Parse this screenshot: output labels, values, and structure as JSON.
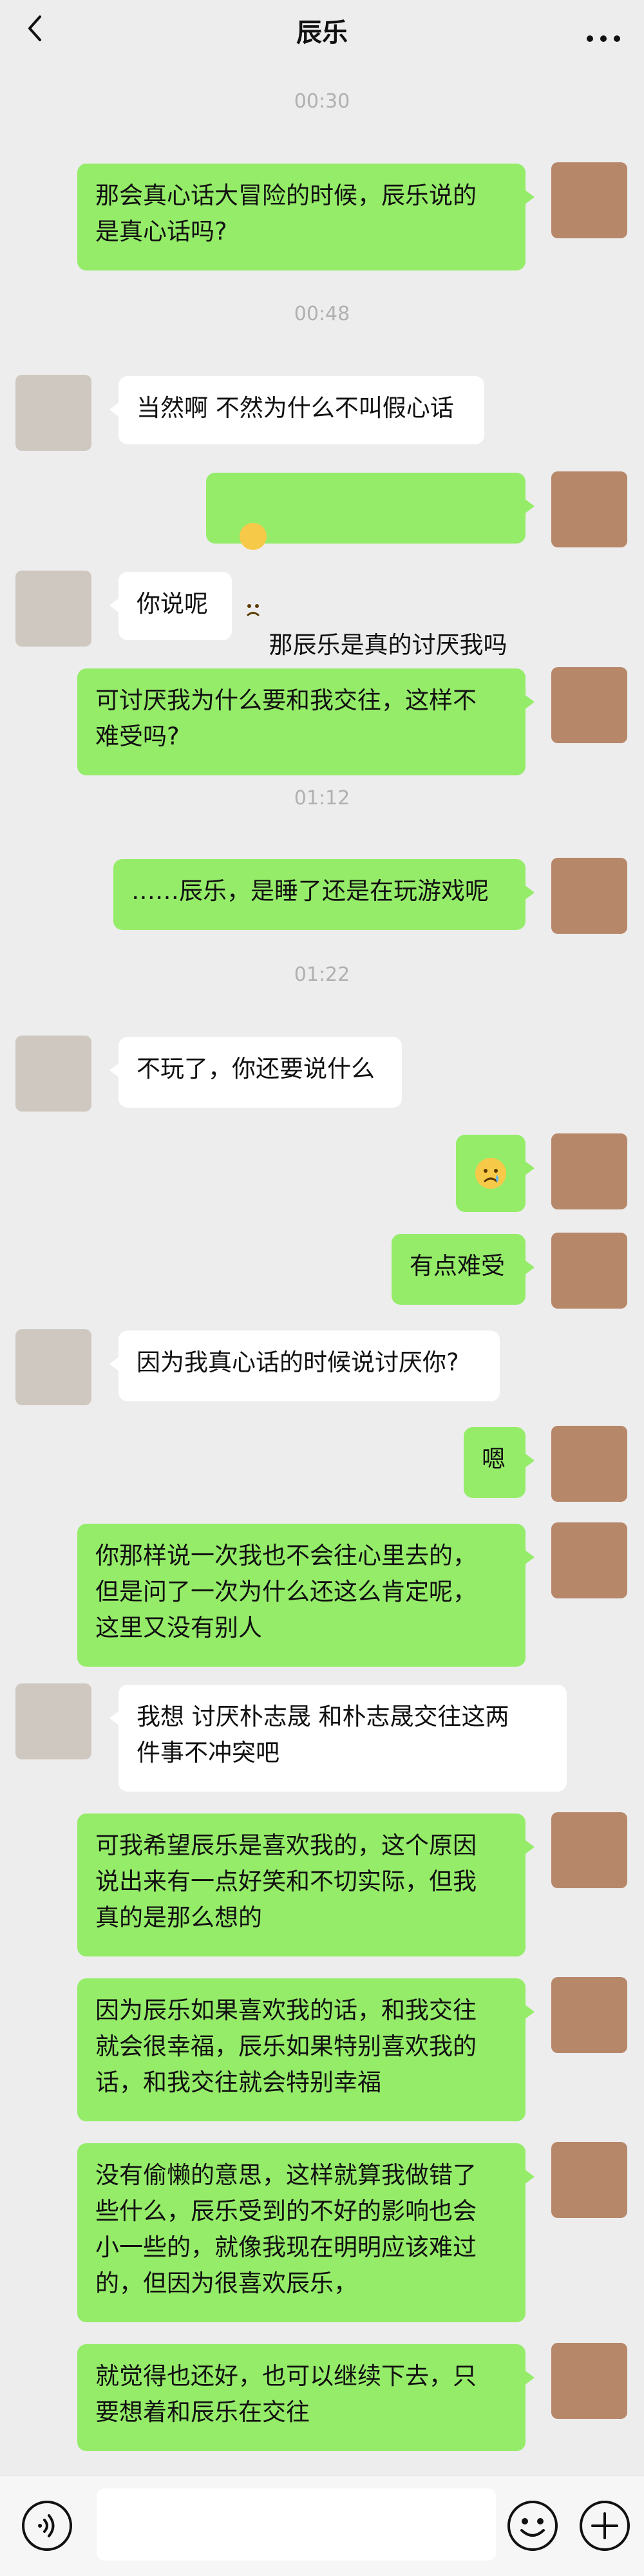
{
  "header": {
    "title": "辰乐"
  },
  "timestamps": [
    "00:30",
    "00:48",
    "01:12",
    "01:22"
  ],
  "messages": [
    {
      "from": "me",
      "text": "那会真心话大冒险的时候，辰乐说的\n是真心话吗?"
    },
    {
      "from": "them",
      "text": "当然啊 不然为什么不叫假心话"
    },
    {
      "from": "me",
      "text": "那辰乐是真的讨厌我吗",
      "emoji": "sad-face"
    },
    {
      "from": "them",
      "text": "你说呢"
    },
    {
      "from": "me",
      "text": "可讨厌我为什么要和我交往，这样不\n难受吗?"
    },
    {
      "from": "me",
      "text": "……辰乐，是睡了还是在玩游戏呢"
    },
    {
      "from": "them",
      "text": "不玩了，你还要说什么"
    },
    {
      "from": "me",
      "text": "",
      "emoji": "crying-face"
    },
    {
      "from": "me",
      "text": "有点难受"
    },
    {
      "from": "them",
      "text": "因为我真心话的时候说讨厌你?"
    },
    {
      "from": "me",
      "text": "嗯"
    },
    {
      "from": "me",
      "text": "你那样说一次我也不会往心里去的，\n但是问了一次为什么还这么肯定呢，\n这里又没有别人"
    },
    {
      "from": "them",
      "text": "我想 讨厌朴志晟 和朴志晟交往这两\n件事不冲突吧"
    },
    {
      "from": "me",
      "text": "可我希望辰乐是喜欢我的，这个原因\n说出来有一点好笑和不切实际，但我\n真的是那么想的"
    },
    {
      "from": "me",
      "text": "因为辰乐如果喜欢我的话，和我交往\n就会很幸福，辰乐如果特别喜欢我的\n话，和我交往就会特别幸福"
    },
    {
      "from": "me",
      "text": "没有偷懒的意思，这样就算我做错了\n些什么，辰乐受到的不好的影响也会\n小一些的，就像我现在明明应该难过\n的，但因为很喜欢辰乐，"
    },
    {
      "from": "me",
      "text": "就觉得也还好，也可以继续下去，只\n要想着和辰乐在交往"
    }
  ],
  "input": {
    "value": "",
    "placeholder": ""
  },
  "colors": {
    "background": "#ededed",
    "my_bubble": "#95ec69",
    "their_bubble": "#ffffff",
    "timestamp": "#b0b0b0"
  },
  "icons": {
    "back": "chevron-left-icon",
    "more": "more-dots-icon",
    "voice": "voice-icon",
    "emoji": "emoji-icon",
    "plus": "plus-icon"
  }
}
